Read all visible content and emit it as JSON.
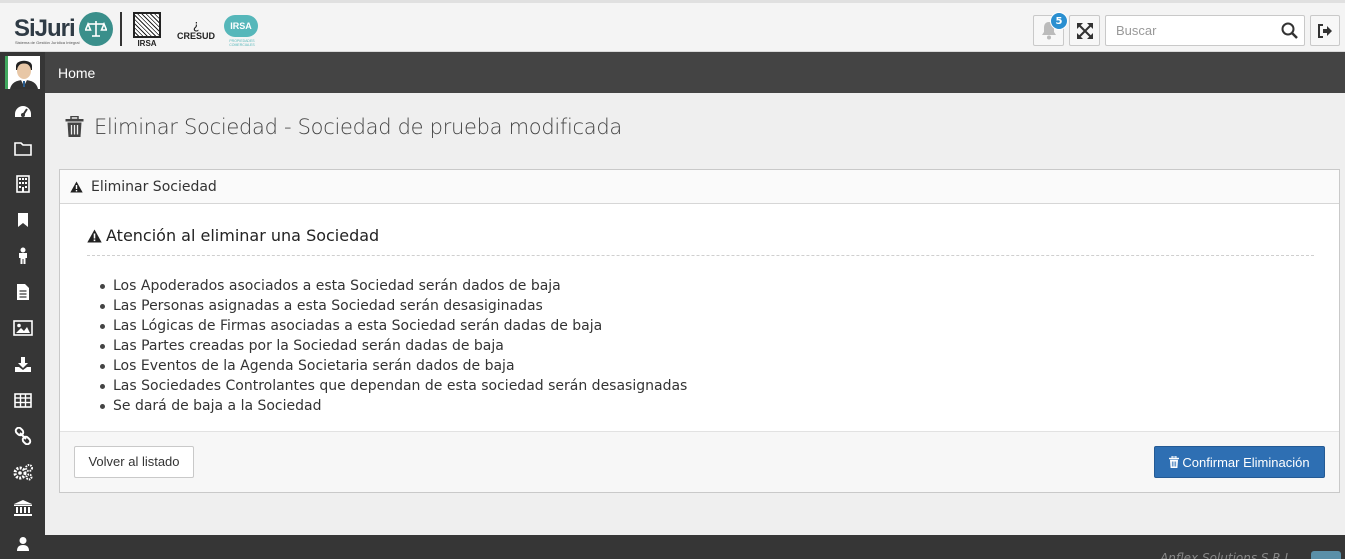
{
  "header": {
    "brand": "SiJuri",
    "brand_sub": "Sistema de Gestión Jurídica Integral",
    "logo_irsa_label": "IRSA",
    "logo_cresud_label": "CRESUD",
    "logo_irsa_comerciales": "IRSA",
    "logo_irsa_comerciales_sub": "PROPIEDADES COMERCIALES",
    "notifications_count": "5",
    "search_placeholder": "Buscar"
  },
  "breadcrumb": {
    "home": "Home"
  },
  "sidebar": {
    "items": [
      {
        "icon": "dashboard-icon"
      },
      {
        "icon": "folder-icon"
      },
      {
        "icon": "building-icon"
      },
      {
        "icon": "bookmark-icon"
      },
      {
        "icon": "person-icon"
      },
      {
        "icon": "file-icon"
      },
      {
        "icon": "image-icon"
      },
      {
        "icon": "download-icon"
      },
      {
        "icon": "table-icon"
      },
      {
        "icon": "link-icon"
      },
      {
        "icon": "gears-icon"
      },
      {
        "icon": "bank-icon"
      },
      {
        "icon": "user-icon"
      }
    ]
  },
  "page": {
    "title": "Eliminar Sociedad - Sociedad de prueba modificada"
  },
  "panel": {
    "heading": "Eliminar Sociedad",
    "warning_title": "Atención al eliminar una Sociedad",
    "items": [
      "Los Apoderados asociados a esta Sociedad serán dados de baja",
      "Las Personas asignadas a esta Sociedad serán desasiginadas",
      "Las Lógicas de Firmas asociadas a esta Sociedad serán dadas de baja",
      "Las Partes creadas por la Sociedad serán dadas de baja",
      "Los Eventos de la Agenda Societaria serán dados de baja",
      "Las Sociedades Controlantes que dependan de esta sociedad serán desasignadas",
      "Se dará de baja a la Sociedad"
    ],
    "back_button": "Volver al listado",
    "confirm_button": "Confirmar Eliminación"
  },
  "footer": {
    "text": "Anflex Solutions S.R.L."
  },
  "colors": {
    "sidebar": "#363636",
    "breadcrumb_bar": "#444444",
    "primary_button": "#2e6fb3",
    "badge": "#2a8fd0",
    "logo_teal": "#3a8f8b"
  }
}
